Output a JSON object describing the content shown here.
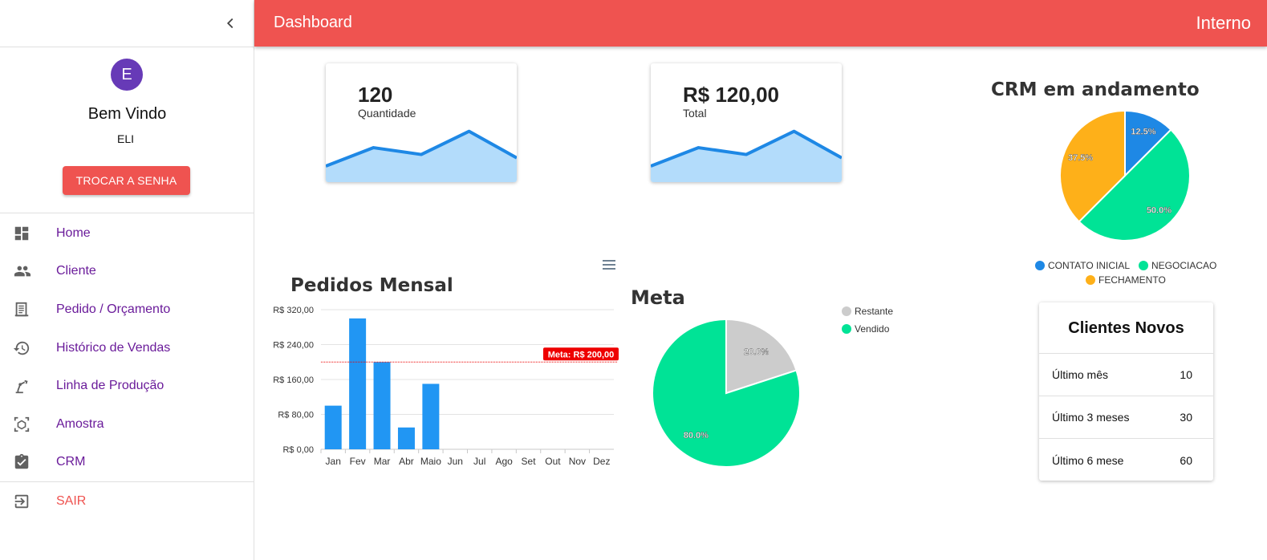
{
  "sidebar": {
    "user_initial": "E",
    "welcome": "Bem Vindo",
    "username": "ELI",
    "change_password": "TROCAR A SENHA",
    "items": [
      {
        "label": "Home",
        "icon": "dashboard-icon"
      },
      {
        "label": "Cliente",
        "icon": "people-icon"
      },
      {
        "label": "Pedido / Orçamento",
        "icon": "receipt-icon"
      },
      {
        "label": "Histórico de Vendas",
        "icon": "history-icon"
      },
      {
        "label": "Linha de Produção",
        "icon": "robot-arm-icon"
      },
      {
        "label": "Amostra",
        "icon": "sample-box-icon"
      },
      {
        "label": "CRM",
        "icon": "clipboard-check-icon"
      }
    ],
    "logout": "SAIR"
  },
  "header": {
    "title": "Dashboard",
    "right": "Interno"
  },
  "cards": [
    {
      "value": "120",
      "caption": "Quantidade"
    },
    {
      "value": "R$ 120,00",
      "caption": "Total"
    }
  ],
  "colors": {
    "primary": "#ef5350",
    "bar": "#2196f3",
    "blue": "#1e88e5",
    "green": "#00e396",
    "orange": "#feb019",
    "grey": "#cccccc",
    "purple": "#6a1b9a"
  },
  "chart_data": [
    {
      "type": "area",
      "values": [
        20,
        47,
        37,
        71,
        32
      ]
    },
    {
      "type": "area",
      "values": [
        20,
        47,
        37,
        71,
        32
      ]
    },
    {
      "type": "bar",
      "title": "Pedidos Mensal",
      "categories": [
        "Jan",
        "Fev",
        "Mar",
        "Abr",
        "Maio",
        "Jun",
        "Jul",
        "Ago",
        "Set",
        "Out",
        "Nov",
        "Dez"
      ],
      "values": [
        100,
        300,
        200,
        50,
        150,
        0,
        0,
        0,
        0,
        0,
        0,
        0
      ],
      "ylim": [
        0,
        320
      ],
      "ytick_labels": [
        "R$ 0,00",
        "R$ 80,00",
        "R$ 160,00",
        "R$ 240,00",
        "R$ 320,00"
      ],
      "yticks": [
        0,
        80,
        160,
        240,
        320
      ],
      "annotation": {
        "y": 200,
        "label": "Meta: R$ 200,00"
      },
      "grid": true
    },
    {
      "type": "pie",
      "title": "Meta",
      "labels": [
        "Restante",
        "Vendido"
      ],
      "values": [
        20.0,
        80.0
      ],
      "value_labels": [
        "20.0%",
        "80.0%"
      ],
      "colors": [
        "#cccccc",
        "#00e396"
      ],
      "legend": "top-right"
    },
    {
      "type": "pie",
      "title": "CRM em andamento",
      "labels": [
        "CONTATO INICIAL",
        "NEGOCIACAO",
        "FECHAMENTO"
      ],
      "values": [
        12.5,
        50.0,
        37.5
      ],
      "value_labels": [
        "12.5%",
        "50.0%",
        "37.5%"
      ],
      "colors": [
        "#1e88e5",
        "#00e396",
        "#feb019"
      ],
      "legend": "bottom"
    }
  ],
  "clients": {
    "title": "Clientes Novos",
    "rows": [
      {
        "label": "Último mês",
        "value": "10"
      },
      {
        "label": "Último 3 meses",
        "value": "30"
      },
      {
        "label": "Último 6 mese",
        "value": "60"
      }
    ]
  }
}
